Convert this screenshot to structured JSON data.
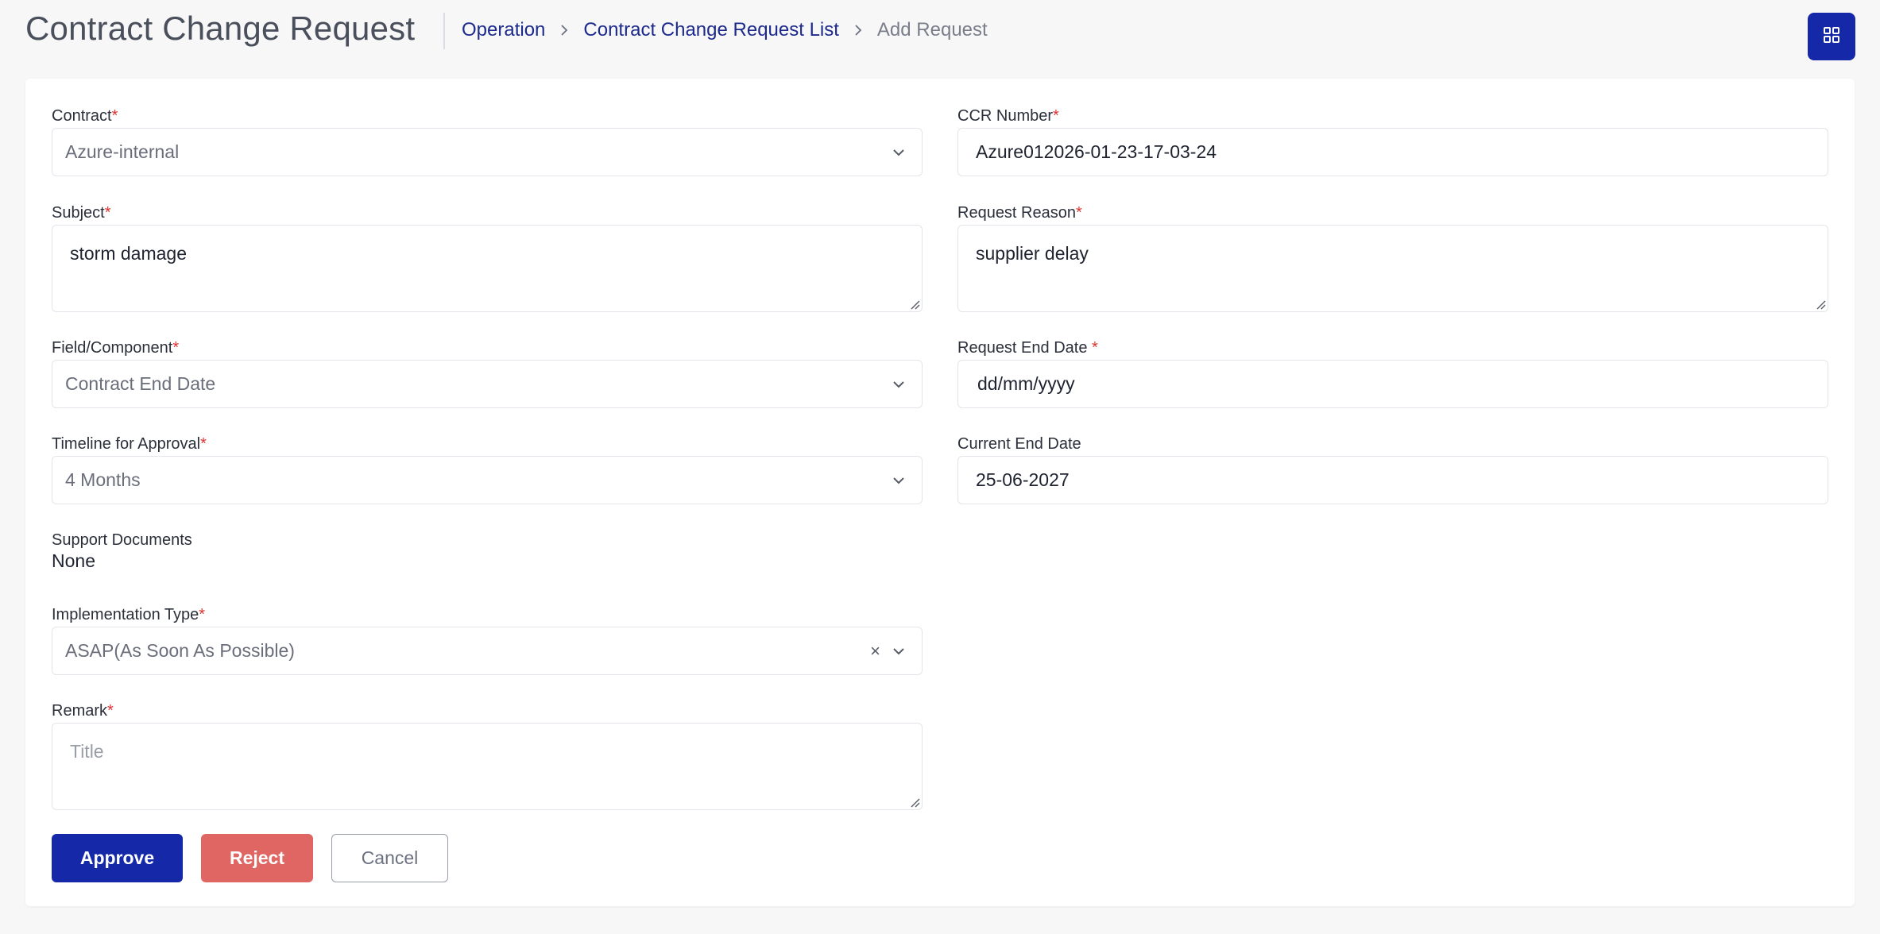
{
  "header": {
    "title": "Contract Change Request",
    "breadcrumb": {
      "operation": "Operation",
      "list": "Contract Change Request List",
      "current": "Add Request"
    },
    "grid_icon": "grid-icon"
  },
  "form": {
    "contract": {
      "label": "Contract",
      "value": "Azure-internal"
    },
    "ccr_number": {
      "label": "CCR Number",
      "value": "Azure012026-01-23-17-03-24"
    },
    "subject": {
      "label": "Subject",
      "value": "storm damage"
    },
    "request_reason": {
      "label": "Request Reason",
      "value": "supplier delay"
    },
    "field_component": {
      "label": "Field/Component",
      "value": "Contract End Date"
    },
    "request_end_date": {
      "label": "Request End Date ",
      "placeholder": "dd/mm/yyyy"
    },
    "timeline": {
      "label": "Timeline for Approval",
      "value": "4 Months"
    },
    "current_end_date": {
      "label": "Current End Date",
      "value": "25-06-2027"
    },
    "support_documents": {
      "label": "Support Documents",
      "value": "None"
    },
    "implementation_type": {
      "label": "Implementation Type",
      "value": "ASAP(As Soon As Possible)",
      "clear": "×"
    },
    "remark": {
      "label": "Remark",
      "placeholder": "Title"
    },
    "required_mark": "*"
  },
  "actions": {
    "approve": "Approve",
    "reject": "Reject",
    "cancel": "Cancel"
  },
  "colors": {
    "primary": "#1428a8",
    "reject": "#df6662",
    "required": "#e0322e",
    "link": "#1c2a8c"
  }
}
